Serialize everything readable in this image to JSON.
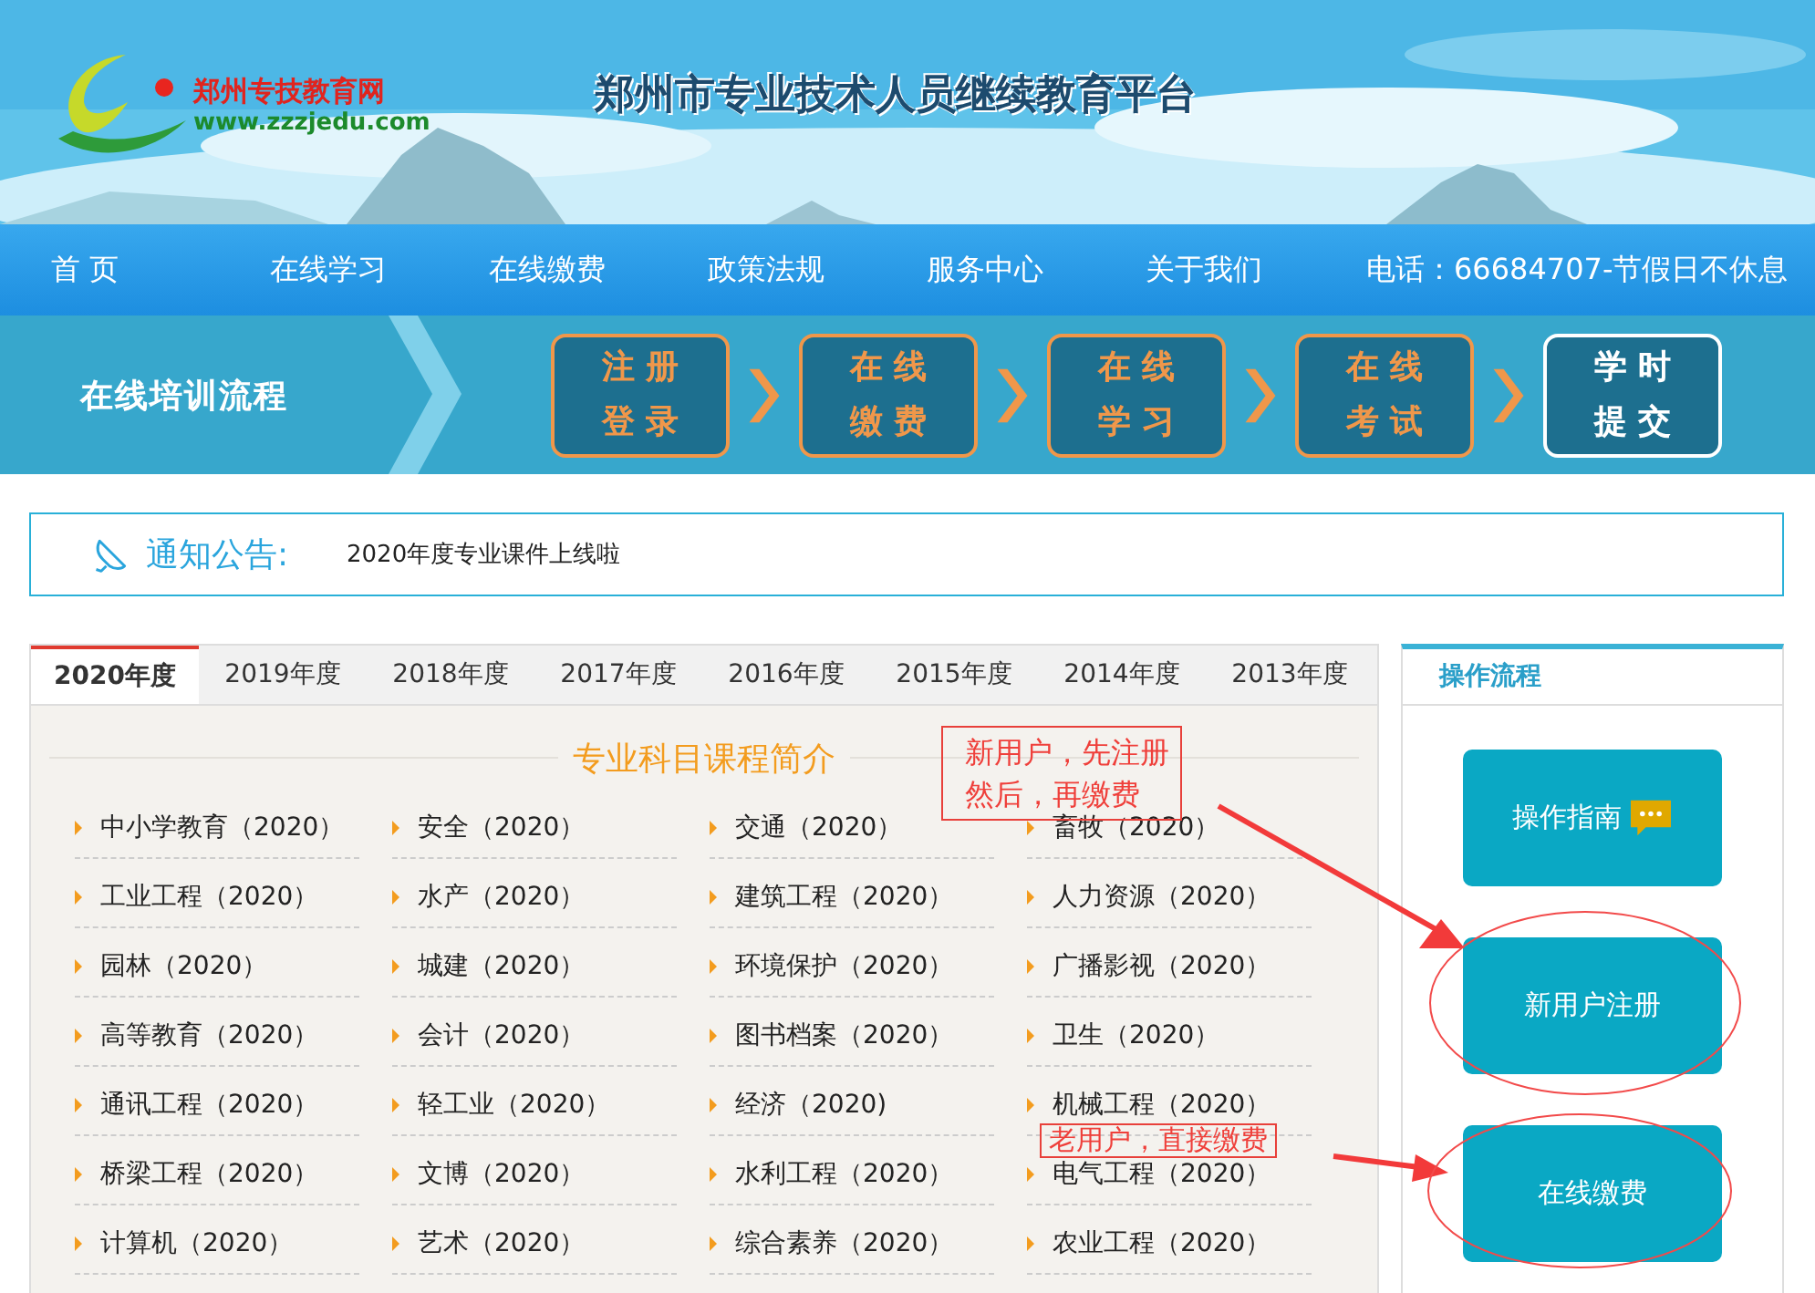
{
  "header": {
    "logo_name": "郑州专技教育网",
    "logo_url": "www.zzzjedu.com",
    "title": "郑州市专业技术人员继续教育平台"
  },
  "nav": {
    "items": [
      {
        "label": "首 页"
      },
      {
        "label": "在线学习"
      },
      {
        "label": "在线缴费"
      },
      {
        "label": "政策法规"
      },
      {
        "label": "服务中心"
      },
      {
        "label": "关于我们"
      }
    ],
    "phone": "电话：66684707-节假日不休息"
  },
  "process": {
    "label": "在线培训流程",
    "steps": [
      {
        "lines": [
          "注册",
          "登录"
        ],
        "color": "#f0974a"
      },
      {
        "lines": [
          "在线",
          "缴费"
        ],
        "color": "#f0974a"
      },
      {
        "lines": [
          "在线",
          "学习"
        ],
        "color": "#f0974a"
      },
      {
        "lines": [
          "在线",
          "考试"
        ],
        "color": "#f0974a"
      },
      {
        "lines": [
          "学时",
          "提交"
        ],
        "color": "#ffffff"
      }
    ]
  },
  "notice": {
    "label": "通知公告:",
    "text": "2020年度专业课件上线啦"
  },
  "courses": {
    "tabs": [
      {
        "label": "2020年度",
        "selected": true
      },
      {
        "label": "2019年度",
        "selected": false
      },
      {
        "label": "2018年度",
        "selected": false
      },
      {
        "label": "2017年度",
        "selected": false
      },
      {
        "label": "2016年度",
        "selected": false
      },
      {
        "label": "2015年度",
        "selected": false
      },
      {
        "label": "2014年度",
        "selected": false
      },
      {
        "label": "2013年度",
        "selected": false
      }
    ],
    "heading": "专业科目课程简介",
    "items": [
      "中小学教育（2020）",
      "安全（2020）",
      "交通（2020）",
      "畜牧（2020）",
      "工业工程（2020）",
      "水产（2020）",
      "建筑工程（2020）",
      "人力资源（2020）",
      "园林（2020）",
      "城建（2020）",
      "环境保护（2020）",
      "广播影视（2020）",
      "高等教育（2020）",
      "会计（2020）",
      "图书档案（2020）",
      "卫生（2020）",
      "通讯工程（2020）",
      "轻工业（2020）",
      "经济（2020)",
      "机械工程（2020）",
      "桥梁工程（2020）",
      "文博（2020）",
      "水利工程（2020）",
      "电气工程（2020）",
      "计算机（2020）",
      "艺术（2020）",
      "综合素养（2020）",
      "农业工程（2020）"
    ]
  },
  "operations": {
    "title": "操作流程",
    "buttons": [
      {
        "label": "操作指南",
        "kind": "guide"
      },
      {
        "label": "新用户注册",
        "kind": "plain"
      },
      {
        "label": "在线缴费",
        "kind": "plain"
      }
    ]
  },
  "annotations": [
    {
      "lines": [
        "新用户，先注册",
        "然后，再缴费"
      ]
    },
    {
      "lines": [
        "老用户，直接缴费"
      ]
    }
  ]
}
